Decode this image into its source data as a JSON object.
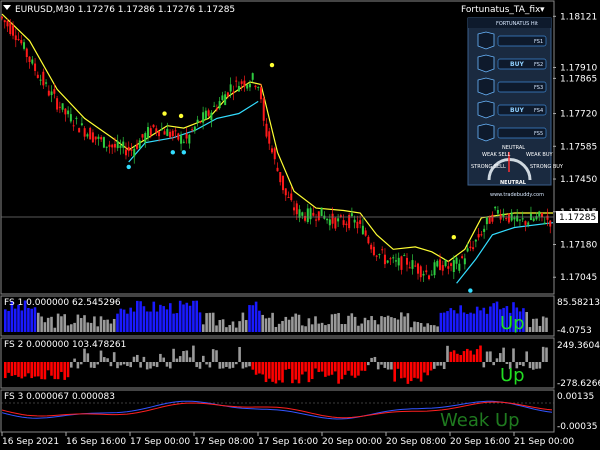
{
  "window": {
    "symbol_label": "EURUSD,M30  1.17276  1.17286  1.17276  1.17285",
    "indicator_name": "Fortunatus_TA_fix",
    "current_price": "1.17285"
  },
  "colors": {
    "bull": "#2ecc40",
    "bear": "#ff1a1a",
    "ma_yellow": "#ffff33",
    "ma_cyan": "#33ddff",
    "hist_blue": "#1a1aff",
    "hist_gray": "#9a9a9a",
    "hist_red": "#ff0000",
    "line_red": "#ff2020",
    "line_blue": "#3355ff",
    "signal_green": "#22dd22",
    "signal_darkgreen": "#1f7a1f"
  },
  "chart_data": [
    {
      "type": "candlestick",
      "title": "EURUSD,M30  1.17276  1.17286  1.17276  1.17285",
      "yticks": [
        "1.18121",
        "1.17910",
        "1.17865",
        "1.17720",
        "1.17585",
        "1.17450",
        "1.17315",
        "1.17180",
        "1.17045"
      ],
      "ylim": [
        1.1698,
        1.1818
      ],
      "xticks": [
        "16 Sep 2021",
        "16 Sep 16:00",
        "17 Sep 00:00",
        "17 Sep 08:00",
        "17 Sep 16:00",
        "20 Sep 00:00",
        "20 Sep 08:00",
        "20 Sep 16:00",
        "21 Sep 00:00"
      ],
      "current_price": 1.17285,
      "close_path": [
        [
          0,
          1.1812
        ],
        [
          6,
          1.1805
        ],
        [
          12,
          1.1792
        ],
        [
          18,
          1.1781
        ],
        [
          24,
          1.1772
        ],
        [
          30,
          1.1766
        ],
        [
          36,
          1.1761
        ],
        [
          42,
          1.1758
        ],
        [
          48,
          1.1757
        ],
        [
          52,
          1.1762
        ],
        [
          56,
          1.1766
        ],
        [
          60,
          1.1765
        ],
        [
          64,
          1.1762
        ],
        [
          68,
          1.1761
        ],
        [
          72,
          1.1768
        ],
        [
          76,
          1.1772
        ],
        [
          80,
          1.1777
        ],
        [
          84,
          1.1783
        ],
        [
          88,
          1.1785
        ],
        [
          92,
          1.1786
        ],
        [
          94,
          1.1784
        ],
        [
          96,
          1.1768
        ],
        [
          100,
          1.1752
        ],
        [
          104,
          1.1738
        ],
        [
          108,
          1.1731
        ],
        [
          112,
          1.173
        ],
        [
          116,
          1.1731
        ],
        [
          120,
          1.1728
        ],
        [
          124,
          1.1727
        ],
        [
          128,
          1.1728
        ],
        [
          132,
          1.1724
        ],
        [
          136,
          1.1716
        ],
        [
          140,
          1.1712
        ],
        [
          144,
          1.171
        ],
        [
          148,
          1.1711
        ],
        [
          152,
          1.1708
        ],
        [
          156,
          1.1706
        ],
        [
          160,
          1.171
        ],
        [
          164,
          1.1708
        ],
        [
          168,
          1.1712
        ],
        [
          172,
          1.1718
        ],
        [
          176,
          1.1725
        ],
        [
          180,
          1.1732
        ],
        [
          184,
          1.173
        ],
        [
          188,
          1.1727
        ],
        [
          192,
          1.1728
        ],
        [
          196,
          1.1729
        ],
        [
          200,
          1.1728
        ]
      ],
      "ma_yellow": [
        [
          0,
          1.1813
        ],
        [
          10,
          1.1802
        ],
        [
          20,
          1.1782
        ],
        [
          30,
          1.177
        ],
        [
          40,
          1.1762
        ],
        [
          46,
          1.1757
        ],
        [
          60,
          1.1767
        ],
        [
          66,
          1.1766
        ],
        [
          75,
          1.177
        ],
        [
          82,
          1.1779
        ],
        [
          90,
          1.1785
        ],
        [
          94,
          1.1784
        ],
        [
          100,
          1.1756
        ],
        [
          106,
          1.174
        ],
        [
          114,
          1.1733
        ],
        [
          124,
          1.1732
        ],
        [
          130,
          1.1731
        ],
        [
          136,
          1.1722
        ],
        [
          142,
          1.1716
        ],
        [
          150,
          1.1717
        ],
        [
          156,
          1.1715
        ],
        [
          162,
          1.1711
        ],
        [
          168,
          1.1716
        ],
        [
          174,
          1.1729
        ],
        [
          186,
          1.1731
        ],
        [
          200,
          1.1731
        ]
      ],
      "ma_cyan": [
        [
          46,
          1.1752
        ],
        [
          52,
          1.176
        ],
        [
          62,
          1.1762
        ],
        [
          70,
          1.1765
        ],
        [
          78,
          1.177
        ],
        [
          86,
          1.1772
        ],
        [
          93,
          1.1777
        ],
        [
          165,
          1.1702
        ],
        [
          172,
          1.1712
        ],
        [
          178,
          1.1722
        ],
        [
          186,
          1.1725
        ],
        [
          200,
          1.1727
        ]
      ],
      "signal_dots": [
        {
          "x": 46,
          "y": 1.175,
          "color": "cyan"
        },
        {
          "x": 62,
          "y": 1.1756,
          "color": "cyan"
        },
        {
          "x": 66,
          "y": 1.1756,
          "color": "cyan"
        },
        {
          "x": 59,
          "y": 1.1772,
          "color": "yellow"
        },
        {
          "x": 65,
          "y": 1.1771,
          "color": "yellow"
        },
        {
          "x": 98,
          "y": 1.1792,
          "color": "yellow"
        },
        {
          "x": 164,
          "y": 1.1721,
          "color": "yellow"
        },
        {
          "x": 170,
          "y": 1.1699,
          "color": "cyan"
        }
      ]
    },
    {
      "type": "histogram",
      "title": "FS 1 0.000000 62.545296",
      "yticks": [
        "85.582136",
        "-4.0753"
      ],
      "signal": "Up"
    },
    {
      "type": "histogram",
      "title": "FS 2 0.000000 103.478261",
      "yticks": [
        "249.36047",
        "-278.62663"
      ],
      "signal": "Up"
    },
    {
      "type": "line",
      "title": "FS 3 0.000067 0.000083",
      "yticks": [
        "0.00135",
        "-0.00035"
      ],
      "signal": "Weak Up"
    }
  ],
  "dashboard": {
    "title": "Fortunatus_TA_fix",
    "header": "FORTUNATUS Hit",
    "rows": [
      {
        "label": "",
        "tf": "FS1"
      },
      {
        "label": "BUY",
        "tf": "FS2"
      },
      {
        "label": "",
        "tf": "FS3"
      },
      {
        "label": "BUY",
        "tf": "FS4"
      },
      {
        "label": "",
        "tf": "FS5"
      }
    ],
    "gauge_label": "NEUTRAL",
    "gauge_top": "NEUTRAL",
    "gauge_left_top": "WEAK SELL",
    "gauge_right_top": "WEAK BUY",
    "gauge_left": "STRONG SELL",
    "gauge_right": "STRONG BUY",
    "footer": "www.tradebuddy.com"
  }
}
